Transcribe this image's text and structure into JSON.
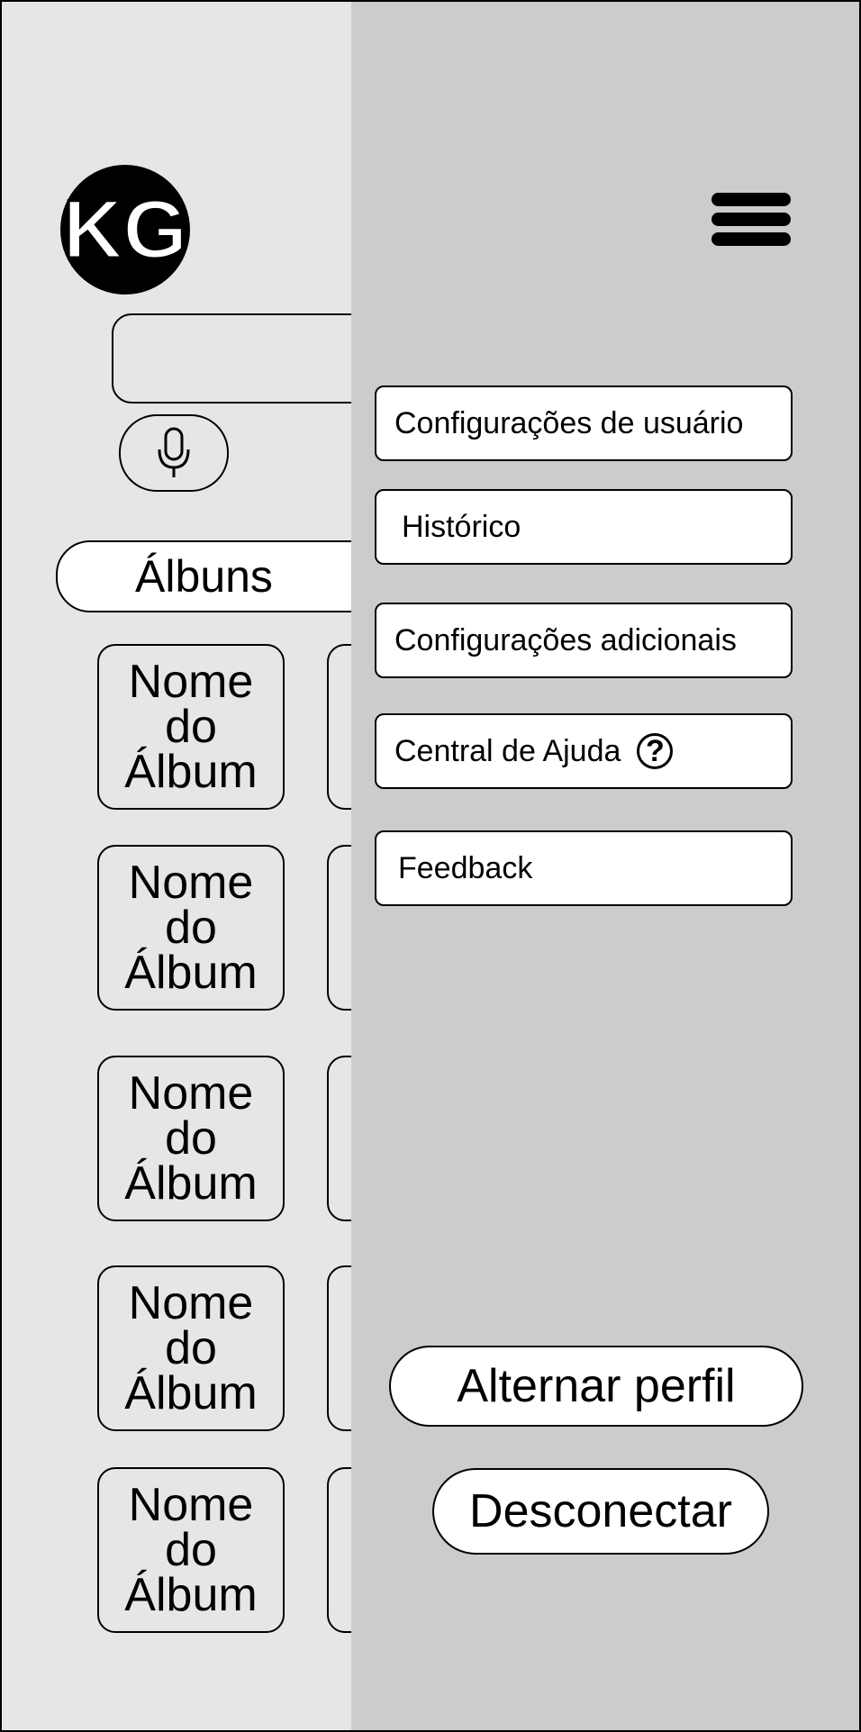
{
  "logo": {
    "text": "KG"
  },
  "search": {
    "placeholder": ""
  },
  "section": {
    "title": "Álbuns"
  },
  "albums": [
    {
      "line1": "Nome",
      "line2": "do",
      "line3": "Álbum"
    },
    {
      "line1": "Nome",
      "line2": "do",
      "line3": "Álbum"
    },
    {
      "line1": "Nome",
      "line2": "do",
      "line3": "Álbum"
    },
    {
      "line1": "Nome",
      "line2": "do",
      "line3": "Álbum"
    },
    {
      "line1": "Nome",
      "line2": "do",
      "line3": "Álbum"
    }
  ],
  "menu": {
    "items": [
      {
        "label": "Configurações de usuário"
      },
      {
        "label": "Histórico"
      },
      {
        "label": "Configurações adicionais"
      },
      {
        "label": "Central de Ajuda",
        "icon": "help-circle-icon",
        "icon_glyph": "?"
      },
      {
        "label": "Feedback"
      }
    ],
    "switch_profile": "Alternar perfil",
    "logout": "Desconectar"
  },
  "colors": {
    "background": "#e6e6e6",
    "drawer": "#cccccc",
    "card": "#ffffff",
    "stroke": "#000000"
  }
}
